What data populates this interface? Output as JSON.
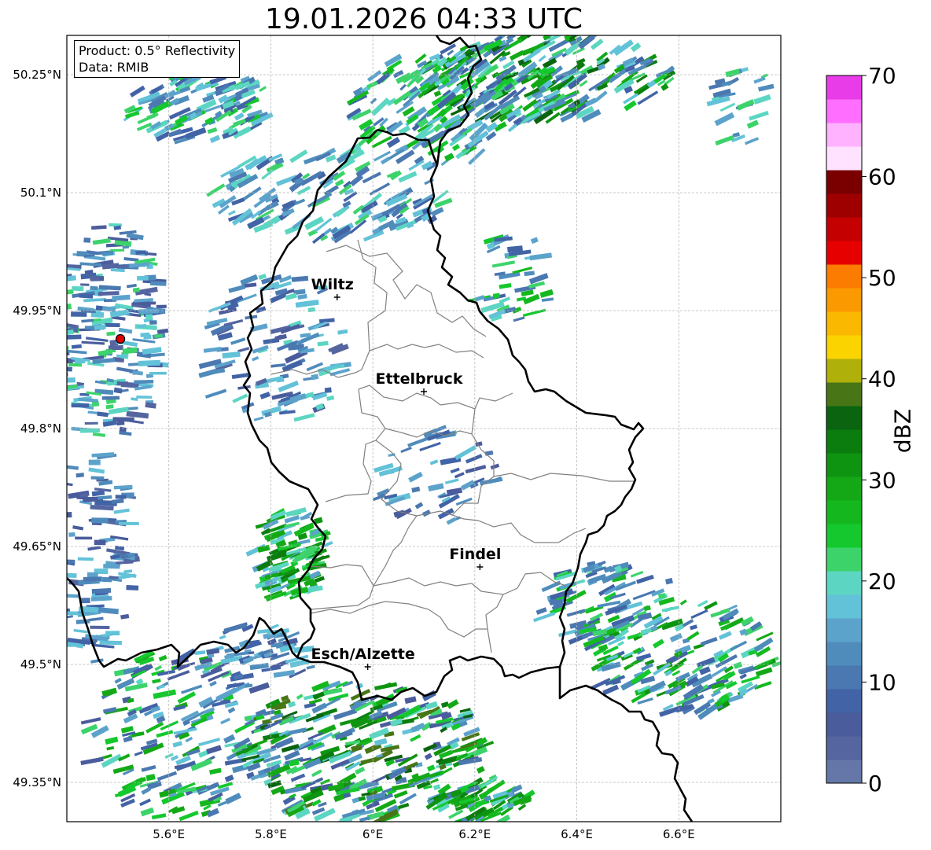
{
  "title": "19.01.2026 04:33 UTC",
  "info": {
    "product": "Product: 0.5° Reflectivity",
    "data": "Data: RMIB"
  },
  "axes": {
    "lon_ticks": [
      {
        "value": 5.6,
        "label": "5.6°E"
      },
      {
        "value": 5.8,
        "label": "5.8°E"
      },
      {
        "value": 6.0,
        "label": "6°E"
      },
      {
        "value": 6.2,
        "label": "6.2°E"
      },
      {
        "value": 6.4,
        "label": "6.4°E"
      },
      {
        "value": 6.6,
        "label": "6.6°E"
      }
    ],
    "lat_ticks": [
      {
        "value": 50.25,
        "label": "50.25°N"
      },
      {
        "value": 50.1,
        "label": "50.1°N"
      },
      {
        "value": 49.95,
        "label": "49.95°N"
      },
      {
        "value": 49.8,
        "label": "49.8°N"
      },
      {
        "value": 49.65,
        "label": "49.65°N"
      },
      {
        "value": 49.5,
        "label": "49.5°N"
      },
      {
        "value": 49.35,
        "label": "49.35°N"
      }
    ],
    "lon_range": [
      5.4,
      6.8
    ],
    "lat_range": [
      49.3,
      50.3
    ],
    "grid": true
  },
  "cities": [
    {
      "name": "Wiltz",
      "lon": 5.93,
      "lat": 49.967
    },
    {
      "name": "Ettelbruck",
      "lon": 6.1,
      "lat": 49.847
    },
    {
      "name": "Findel",
      "lon": 6.21,
      "lat": 49.624
    },
    {
      "name": "Esch/Alzette",
      "lon": 5.99,
      "lat": 49.497
    }
  ],
  "radar_site": {
    "lon": 5.505,
    "lat": 49.914
  },
  "colorbar": {
    "label": "dBZ",
    "min": 0,
    "max": 70,
    "ticks": [
      {
        "value": 0,
        "label": "0"
      },
      {
        "value": 10,
        "label": "10"
      },
      {
        "value": 20,
        "label": "20"
      },
      {
        "value": 30,
        "label": "30"
      },
      {
        "value": 40,
        "label": "40"
      },
      {
        "value": 50,
        "label": "50"
      },
      {
        "value": 60,
        "label": "60"
      },
      {
        "value": 70,
        "label": "70"
      }
    ],
    "colors": [
      "#6577a8",
      "#5465a0",
      "#4a5c9c",
      "#4263a6",
      "#4b78b0",
      "#4f8cbc",
      "#5ca3cc",
      "#62c2d8",
      "#5cd6c2",
      "#3dd36b",
      "#14c82d",
      "#14b81e",
      "#14a816",
      "#0e9410",
      "#0b7d0f",
      "#0a6410",
      "#487617",
      "#b0b00a",
      "#fbd400",
      "#fbb800",
      "#fb9900",
      "#fb7c00",
      "#e60000",
      "#c40000",
      "#9e0000",
      "#7a0000",
      "#ffe2ff",
      "#ffb2ff",
      "#ff6eff",
      "#e93ce9"
    ]
  },
  "map_colors": {
    "national_border": "#000000",
    "canton_border": "#808080",
    "grid": "#b8b8b8"
  }
}
